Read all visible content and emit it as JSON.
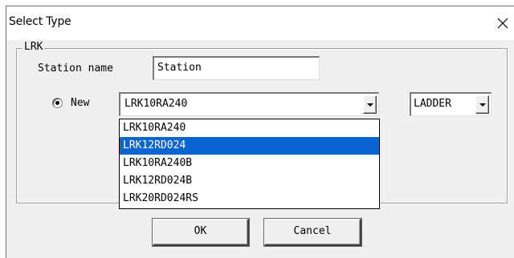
{
  "window": {
    "title": "Select Type"
  },
  "group": {
    "title": "LRK"
  },
  "station": {
    "label": "Station name",
    "value": "Station"
  },
  "mode": {
    "radio_label": "New",
    "selected": true
  },
  "type_combo": {
    "value": "LRK10RA240",
    "options": [
      "LRK10RA240",
      "LRK12RD024",
      "LRK10RA240B",
      "LRK12RD024B",
      "LRK20RD024RS"
    ],
    "highlighted": "LRK12RD024"
  },
  "lang_combo": {
    "value": "LADDER"
  },
  "buttons": {
    "ok": "OK",
    "cancel": "Cancel"
  },
  "colors": {
    "highlight": "#0a64d2",
    "dialog_bg": "#f0f0f0"
  },
  "icons": {
    "close": "close-icon",
    "dropdown": "chevron-down-icon"
  }
}
